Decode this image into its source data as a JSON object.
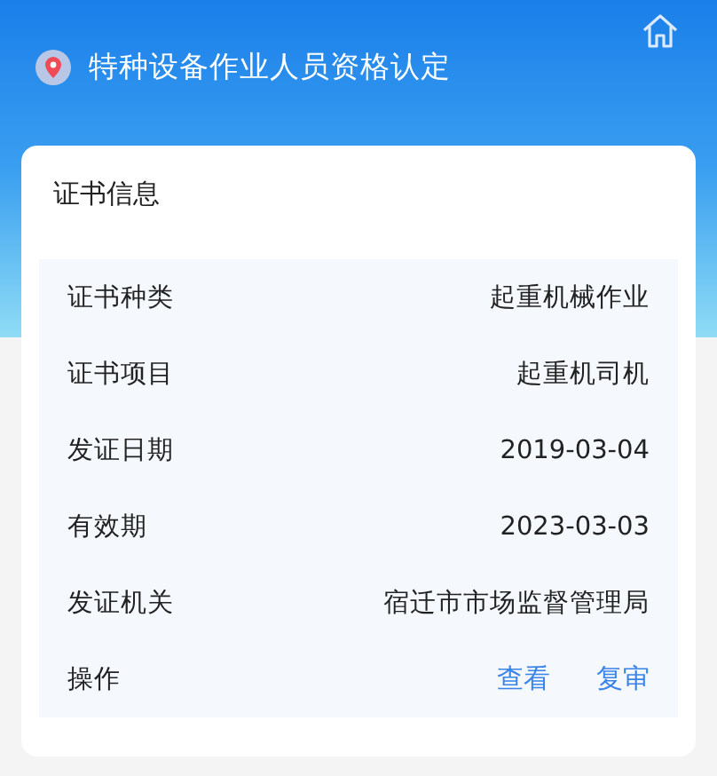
{
  "header": {
    "title": "特种设备作业人员资格认定"
  },
  "card": {
    "title": "证书信息",
    "rows": [
      {
        "kind": "field",
        "label": "证书种类",
        "value": "起重机械作业"
      },
      {
        "kind": "field",
        "label": "证书项目",
        "value": "起重机司机"
      },
      {
        "kind": "field",
        "label": "发证日期",
        "value": "2019-03-04"
      },
      {
        "kind": "field",
        "label": "有效期",
        "value": "2023-03-03"
      },
      {
        "kind": "field",
        "label": "发证机关",
        "value": "宿迁市市场监督管理局"
      },
      {
        "kind": "actions",
        "label": "操作",
        "links": [
          "查看",
          "复审"
        ]
      }
    ]
  }
}
